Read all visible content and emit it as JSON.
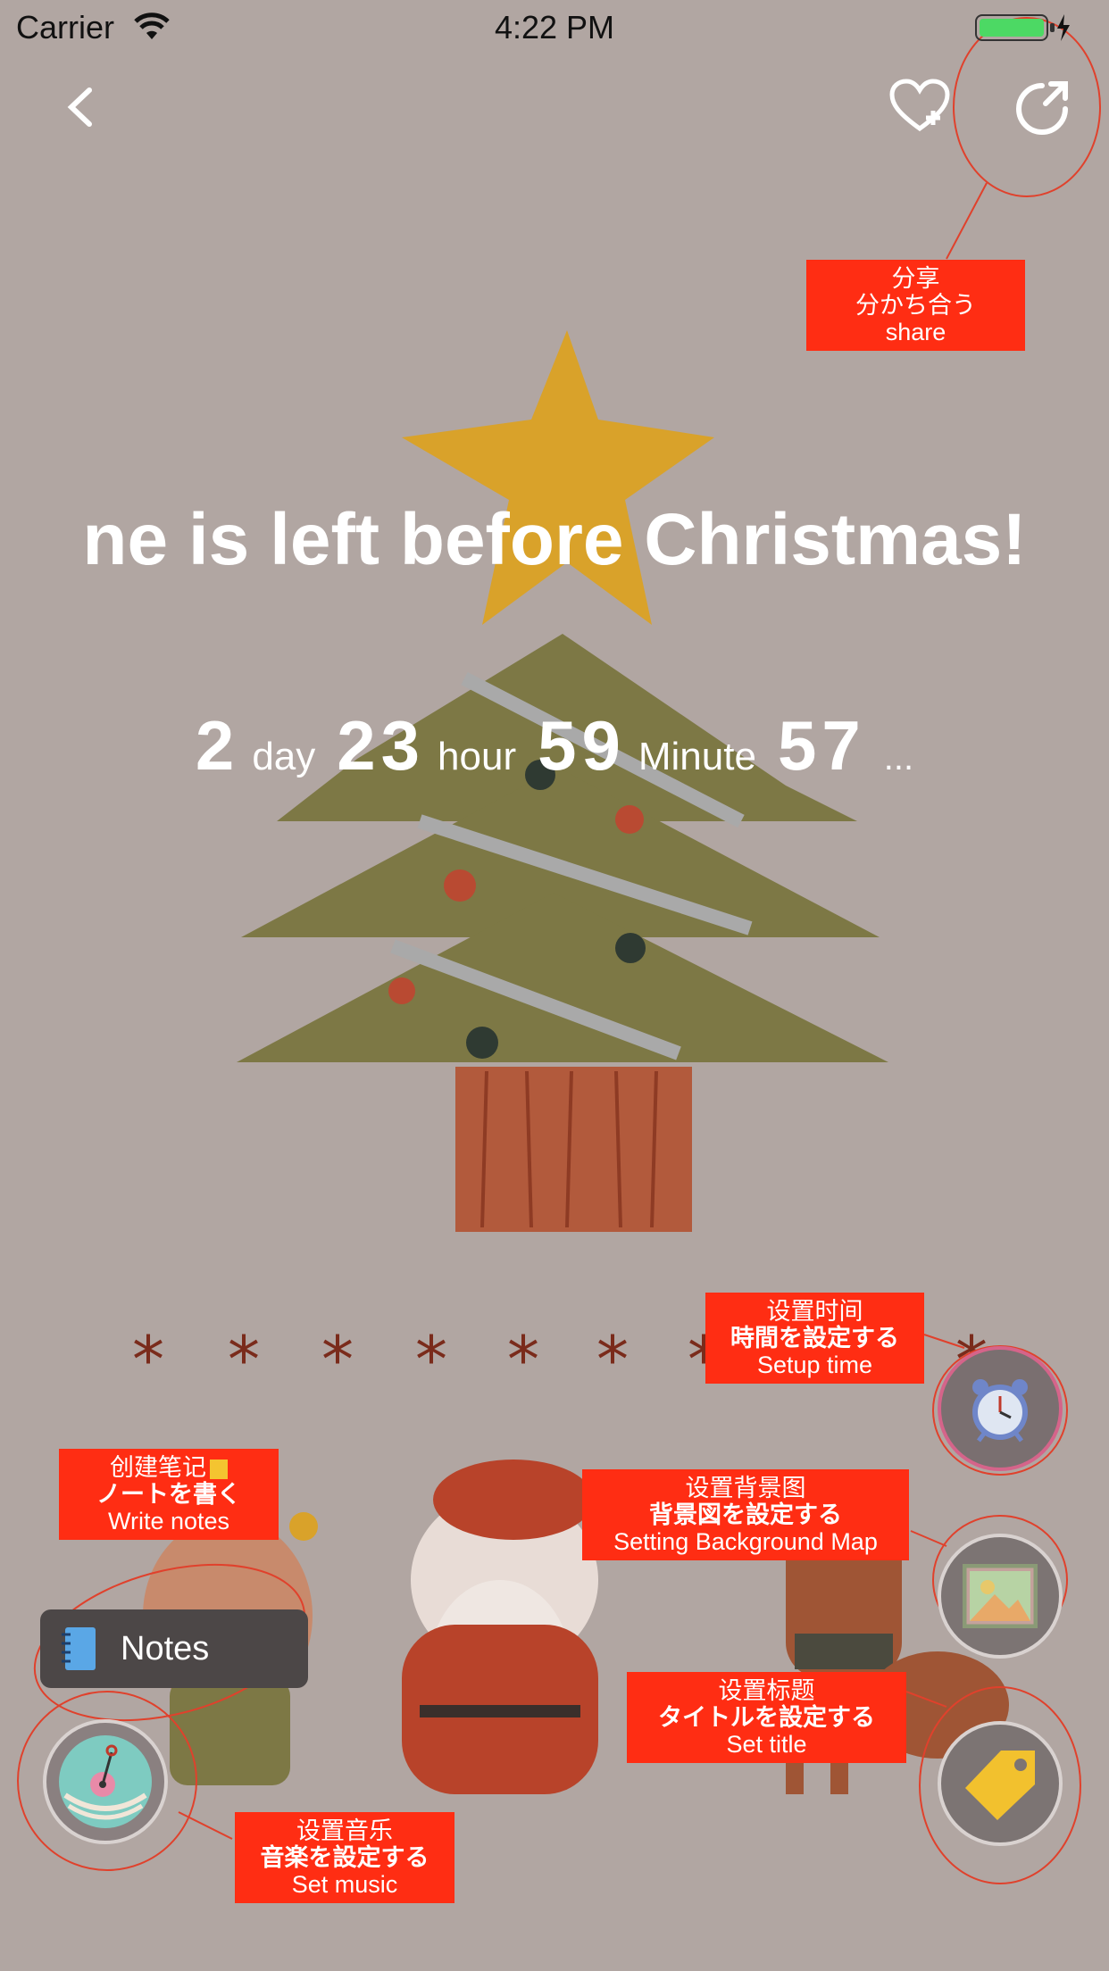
{
  "status_bar": {
    "carrier": "Carrier",
    "time": "4:22 PM"
  },
  "nav": {
    "back_icon": "chevron-left-icon",
    "favorite_icon": "heart-plus-icon",
    "share_icon": "share-icon"
  },
  "headline": "ne is left before Christmas!",
  "countdown": {
    "days": "2",
    "days_unit": "day",
    "hours": "23",
    "hours_unit": "hour",
    "minutes": "59",
    "minutes_unit": "Minute",
    "seconds": "57",
    "more": "..."
  },
  "annotations": {
    "share": {
      "zh": "分享",
      "ja": "分かち合う",
      "en": "share"
    },
    "setup_time": {
      "zh": "设置时间",
      "ja": "時間を設定する",
      "en": "Setup time"
    },
    "write_notes": {
      "zh": "创建笔记",
      "ja": "ノートを書く",
      "en": "Write notes"
    },
    "background": {
      "zh": "设置背景图",
      "ja": "背景図を設定する",
      "en": "Setting Background Map"
    },
    "set_title": {
      "zh": "设置标题",
      "ja": "タイトルを設定する",
      "en": "Set title"
    },
    "set_music": {
      "zh": "设置音乐",
      "ja": "音楽を設定する",
      "en": "Set music"
    }
  },
  "notes_button": {
    "label": "Notes",
    "icon": "notebook-icon"
  },
  "colors": {
    "background": "#b1a6a2",
    "annotation": "#ff2d13",
    "annotation_circle": "#e0412c",
    "star": "#d9a22a",
    "tree": "#7d7845",
    "trunk": "#b25a3c"
  }
}
